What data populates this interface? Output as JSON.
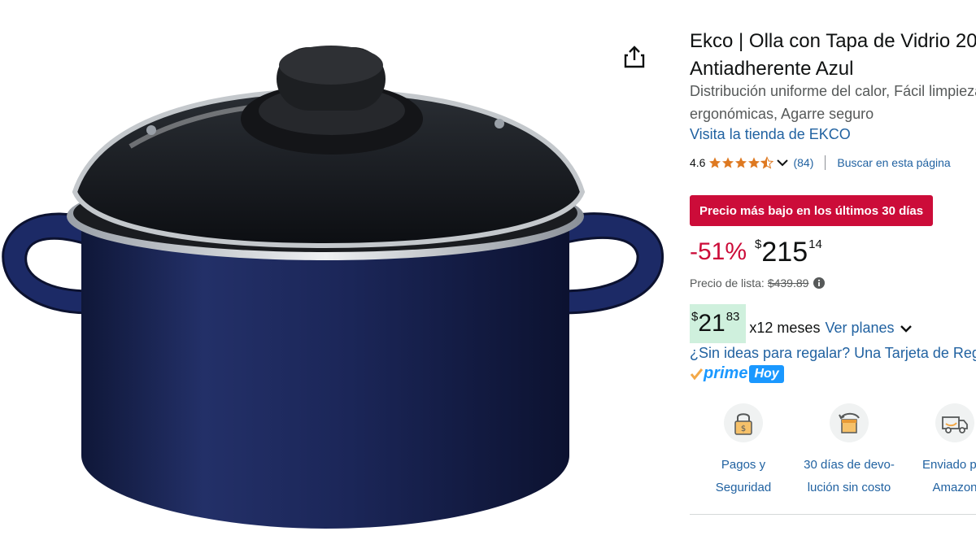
{
  "product": {
    "title_line1": "Ekco | Olla con Tapa de Vidrio 20",
    "title_line2": "Antiadherente Azul",
    "subtitle_line1": "Distribución uniforme del calor, Fácil limpieza",
    "subtitle_line2": "ergonómicas, Agarre seguro",
    "store_link": "Visita la tienda de EKCO",
    "rating": "4.6",
    "review_count": "(84)",
    "search_page": "Buscar en esta página"
  },
  "deal_badge": "Precio más bajo en los últimos 30 días",
  "price": {
    "discount": "-51%",
    "currency": "$",
    "whole": "215",
    "fraction": "14",
    "list_label": "Precio de lista:",
    "list_value": "$439.89"
  },
  "installments": {
    "currency": "$",
    "whole": "21",
    "fraction": "83",
    "months": "x12 meses",
    "plans_link": "Ver planes"
  },
  "gift_link": "¿Sin ideas para regalar? Una Tarjeta de Regalo",
  "prime": {
    "logo_text": "prime",
    "today": "Hoy"
  },
  "features": [
    {
      "line1": "Pagos y",
      "line2": "Seguridad",
      "icon": "secure-payment-icon"
    },
    {
      "line1": "30 días de devo-",
      "line2": "lución sin costo",
      "icon": "return-box-icon"
    },
    {
      "line1": "Enviado por",
      "line2": "Amazon",
      "icon": "delivery-truck-icon"
    }
  ],
  "colors": {
    "link": "#2162a1",
    "deal_red": "#cc0c39",
    "install_bg": "#cff0dd",
    "prime_blue": "#1a98ff",
    "star": "#de7921"
  }
}
